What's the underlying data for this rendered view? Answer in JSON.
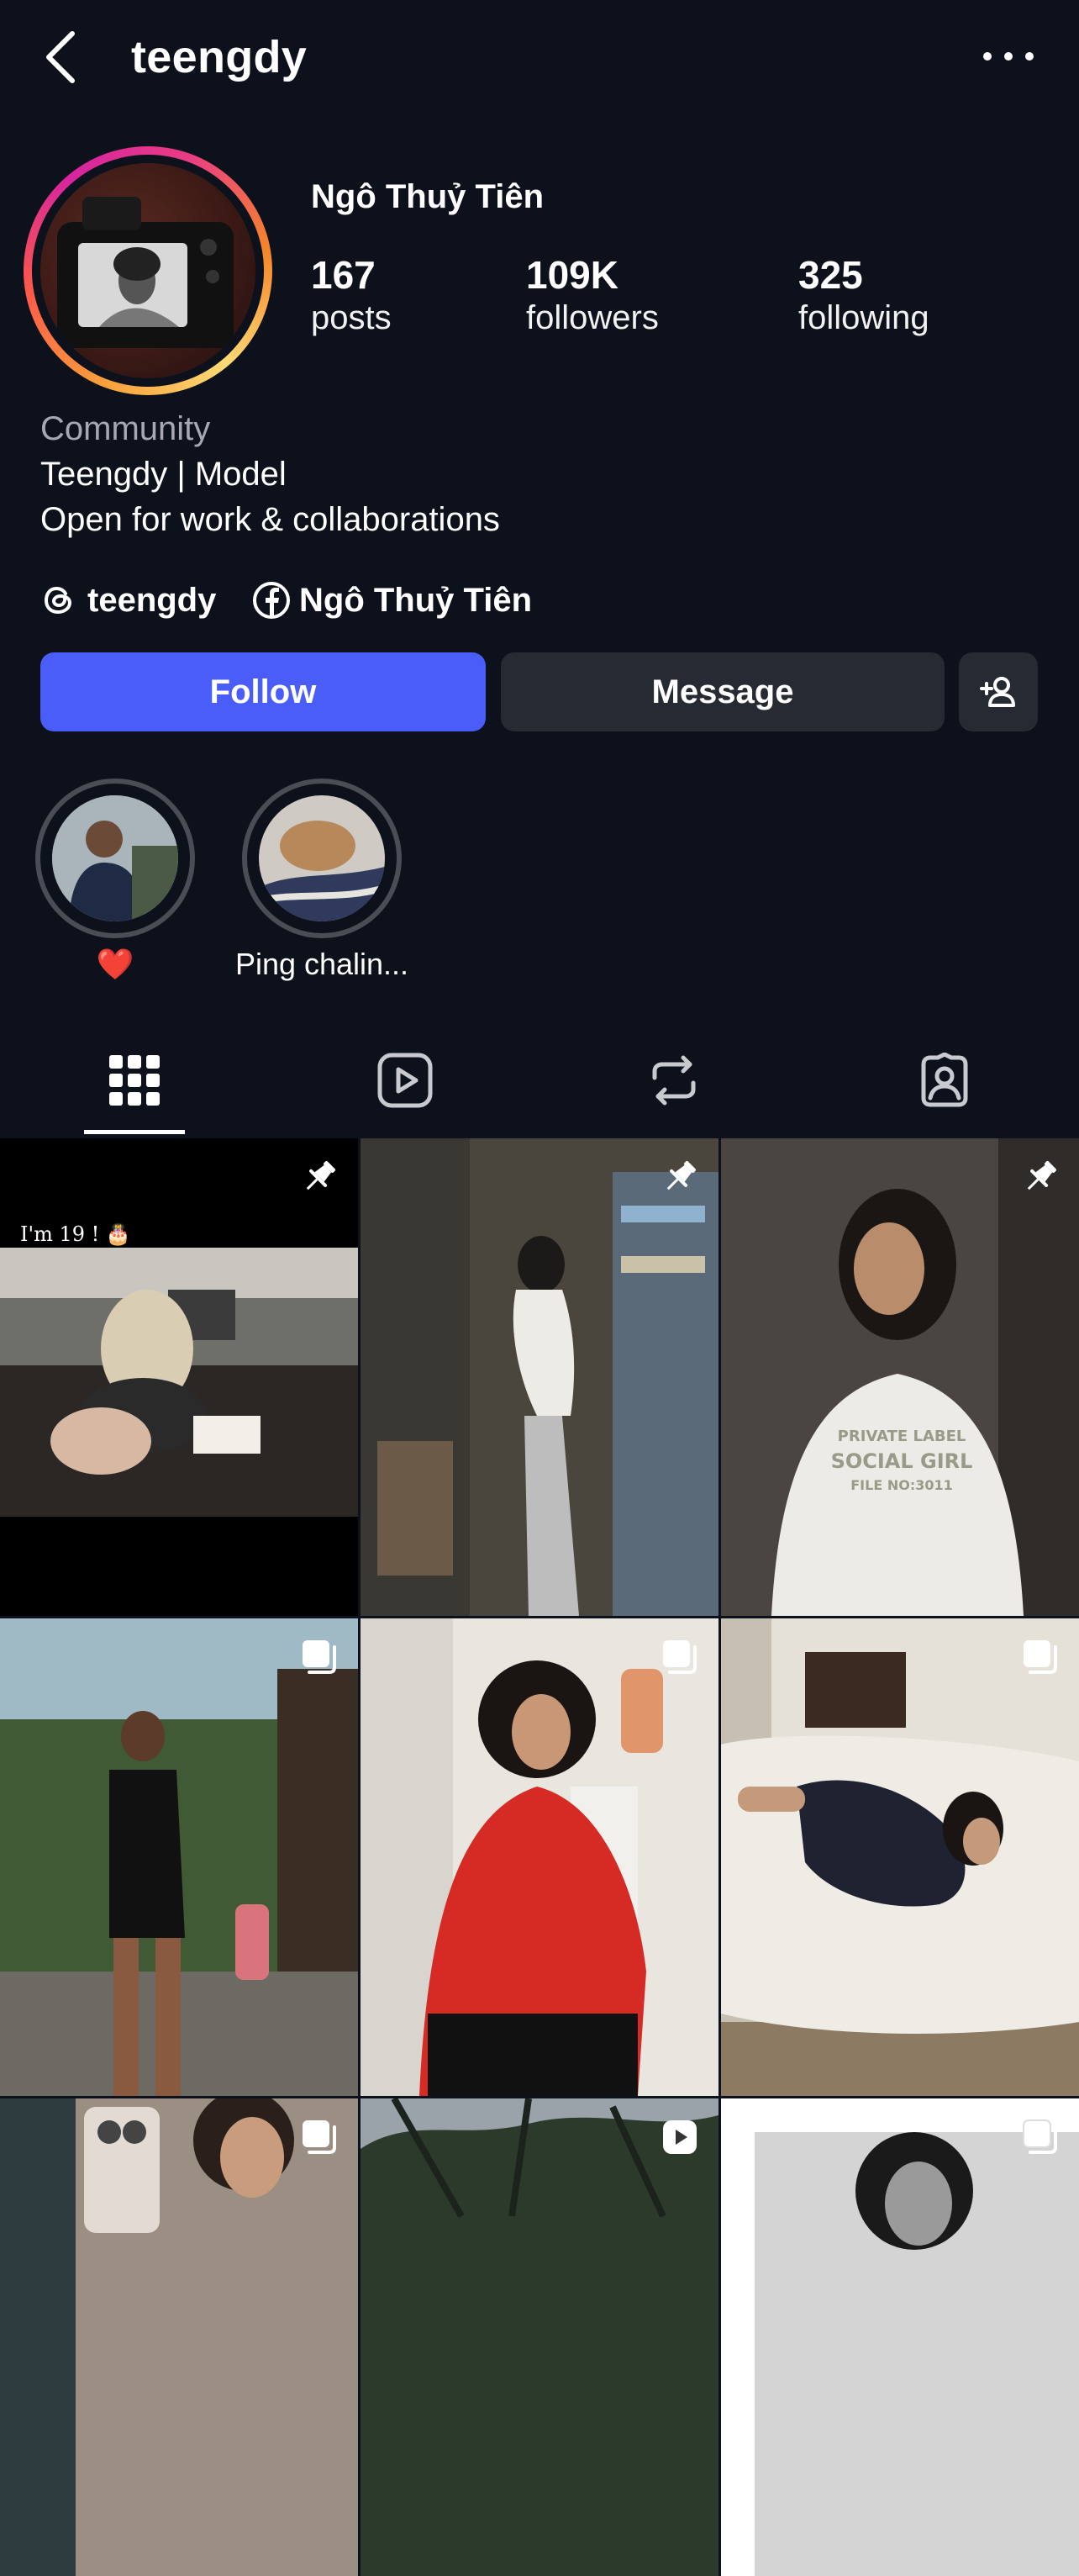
{
  "header": {
    "username": "teengdy",
    "back_icon": "chevron-left-icon",
    "more_icon": "more-horizontal-icon"
  },
  "profile": {
    "display_name": "Ngô Thuỷ Tiên",
    "stats": [
      {
        "value": "167",
        "label": "posts"
      },
      {
        "value": "109K",
        "label": "followers"
      },
      {
        "value": "325",
        "label": "following"
      }
    ],
    "category": "Community",
    "bio": [
      "Teengdy | Model",
      "Open for work & collaborations"
    ],
    "links": {
      "threads": "teengdy",
      "facebook": "Ngô Thuỷ Tiên"
    }
  },
  "actions": {
    "follow_label": "Follow",
    "message_label": "Message",
    "suggest_icon": "add-person-icon",
    "follow_color": "#4a5df9"
  },
  "highlights": [
    {
      "label": "❤️"
    },
    {
      "label": "Ping chalin..."
    }
  ],
  "tabs": [
    {
      "name": "posts",
      "icon": "grid-icon",
      "selected": true
    },
    {
      "name": "reels",
      "icon": "reels-icon",
      "selected": false
    },
    {
      "name": "reposts",
      "icon": "repost-icon",
      "selected": false
    },
    {
      "name": "tagged",
      "icon": "tagged-icon",
      "selected": false
    }
  ],
  "grid": {
    "tiles": [
      {
        "badge": "pin-icon",
        "caption": "I'm 19 ! 🎂"
      },
      {
        "badge": "pin-icon"
      },
      {
        "badge": "pin-icon",
        "shirt_text": "PRIVATE LABEL SOCIAL GIRL FILE NO:3011"
      },
      {
        "badge": "carousel-icon"
      },
      {
        "badge": "carousel-icon"
      },
      {
        "badge": "carousel-icon"
      },
      {
        "badge": "carousel-icon"
      },
      {
        "badge": "reel-icon"
      },
      {
        "badge": "carousel-icon"
      }
    ]
  }
}
